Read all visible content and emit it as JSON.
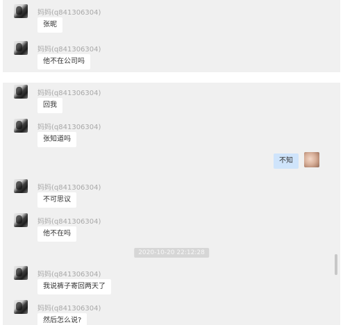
{
  "top_panel": {
    "messages": [
      {
        "sender": "妈妈(q841306304)",
        "text": "张昵"
      },
      {
        "sender": "妈妈(q841306304)",
        "text": "他不在公司吗"
      }
    ]
  },
  "main_panel": {
    "messages": [
      {
        "sender": "妈妈(q841306304)",
        "text": "回我"
      },
      {
        "sender": "妈妈(q841306304)",
        "text": "张知道吗"
      },
      {
        "sender": "妈妈(q841306304)",
        "text": "不可思议"
      },
      {
        "sender": "妈妈(q841306304)",
        "text": "他不在吗"
      },
      {
        "sender": "妈妈(q841306304)",
        "text": "我说裤子寄回两天了"
      },
      {
        "sender": "妈妈(q841306304)",
        "text": "然后怎么说?"
      }
    ],
    "self_message": {
      "text": "不知"
    },
    "timestamp": "2020-10-20 22:12:28"
  }
}
